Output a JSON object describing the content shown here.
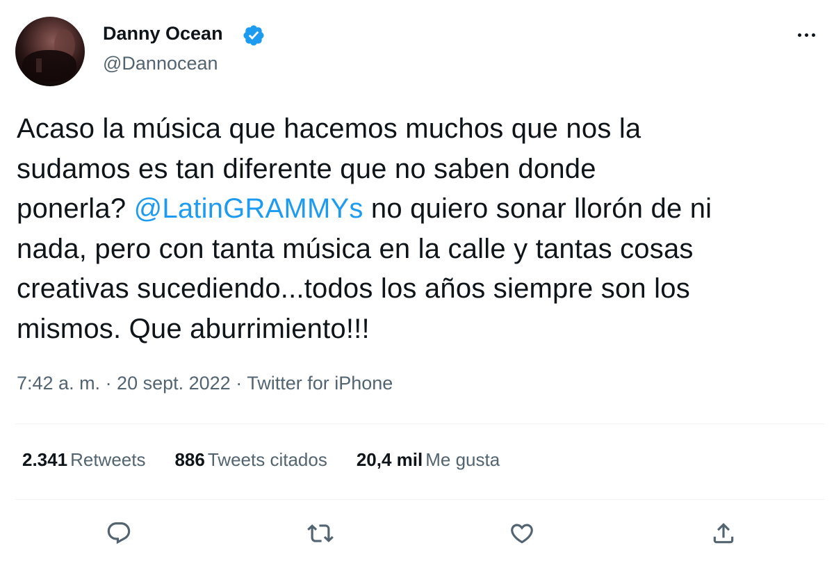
{
  "author": {
    "display_name": "Danny Ocean",
    "handle": "@Dannocean",
    "verified": true
  },
  "tweet": {
    "lines": [
      [
        "Acaso la música que hacemos muchos que nos la"
      ],
      [
        "sudamos es tan diferente que no saben donde"
      ],
      [
        "ponerla? ",
        "@LatinGRAMMYs",
        " no quiero sonar llorón de ni"
      ],
      [
        "nada, pero con tanta música en la calle y tantas cosas"
      ],
      [
        "creativas sucediendo...todos los años siempre son los"
      ],
      [
        "mismos. Que aburrimiento!!!"
      ]
    ],
    "mention": "@LatinGRAMMYs"
  },
  "meta": {
    "text": "7:42 a. m. · 20 sept. 2022 · Twitter for iPhone"
  },
  "stats": [
    {
      "count": "2.341",
      "label": "Retweets"
    },
    {
      "count": "886",
      "label": "Tweets citados"
    },
    {
      "count": "20,4 mil",
      "label": "Me gusta"
    }
  ],
  "actions": {
    "reply_icon": "reply-icon",
    "retweet_icon": "retweet-icon",
    "like_icon": "heart-icon",
    "share_icon": "share-icon"
  },
  "colors": {
    "text": "#0f1419",
    "secondary": "#536471",
    "link": "#1d9bf0",
    "verified": "#1d9bf0",
    "divider": "#eff3f4"
  }
}
